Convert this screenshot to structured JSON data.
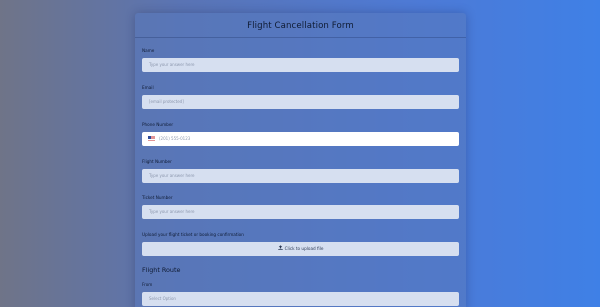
{
  "form": {
    "title": "Flight Cancellation Form",
    "fields": [
      {
        "label": "Name",
        "placeholder": "Type your answer here"
      },
      {
        "label": "Email",
        "placeholder": "[email protected]"
      },
      {
        "label": "Phone Number",
        "placeholder": "(201) 555-0123",
        "country_flag": "us-flag-icon"
      },
      {
        "label": "Flight Number",
        "placeholder": "Type your answer here"
      },
      {
        "label": "Ticket Number",
        "placeholder": "Type your answer here"
      }
    ],
    "upload": {
      "label": "Upload your flight ticket or booking confirmation",
      "button_label": "Click to upload file",
      "icon": "upload-icon"
    },
    "section": {
      "title": "Flight Route",
      "from_label": "From",
      "from_placeholder": "Select Option"
    }
  },
  "colors": {
    "background_start": "#6f7488",
    "background_end": "#3f80e6",
    "input_bg": "#d6dff0",
    "text": "#0f1b33"
  }
}
